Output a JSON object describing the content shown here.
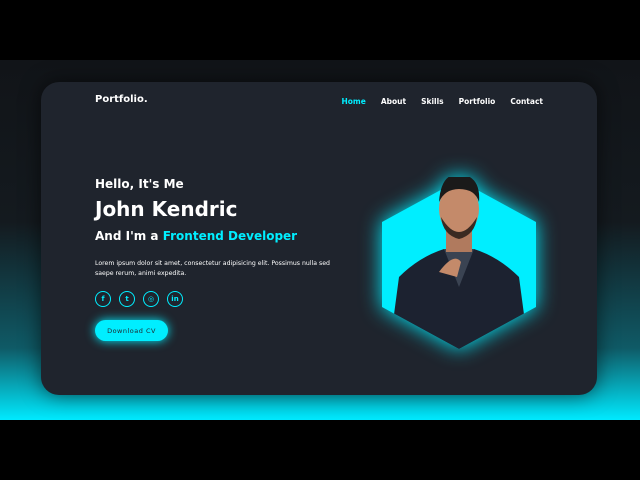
{
  "header": {
    "logo": "Portfolio.",
    "nav": [
      {
        "label": "Home",
        "active": true
      },
      {
        "label": "About"
      },
      {
        "label": "Skills"
      },
      {
        "label": "Portfolio"
      },
      {
        "label": "Contact"
      }
    ]
  },
  "hero": {
    "greeting": "Hello, It's Me",
    "name": "John Kendric",
    "role_prefix": "And I'm a",
    "role": "Frontend Developer",
    "description": "Lorem ipsum dolor sit amet, consectetur adipisicing elit. Possimus nulla sed saepe rerum, animi expedita.",
    "social": [
      {
        "icon": "facebook-icon",
        "glyph": "f"
      },
      {
        "icon": "twitter-icon",
        "glyph": "t"
      },
      {
        "icon": "instagram-icon",
        "glyph": "◎"
      },
      {
        "icon": "linkedin-icon",
        "glyph": "in"
      }
    ],
    "cta": "Download CV"
  },
  "colors": {
    "accent": "#00eeff",
    "card": "#1f242d"
  }
}
